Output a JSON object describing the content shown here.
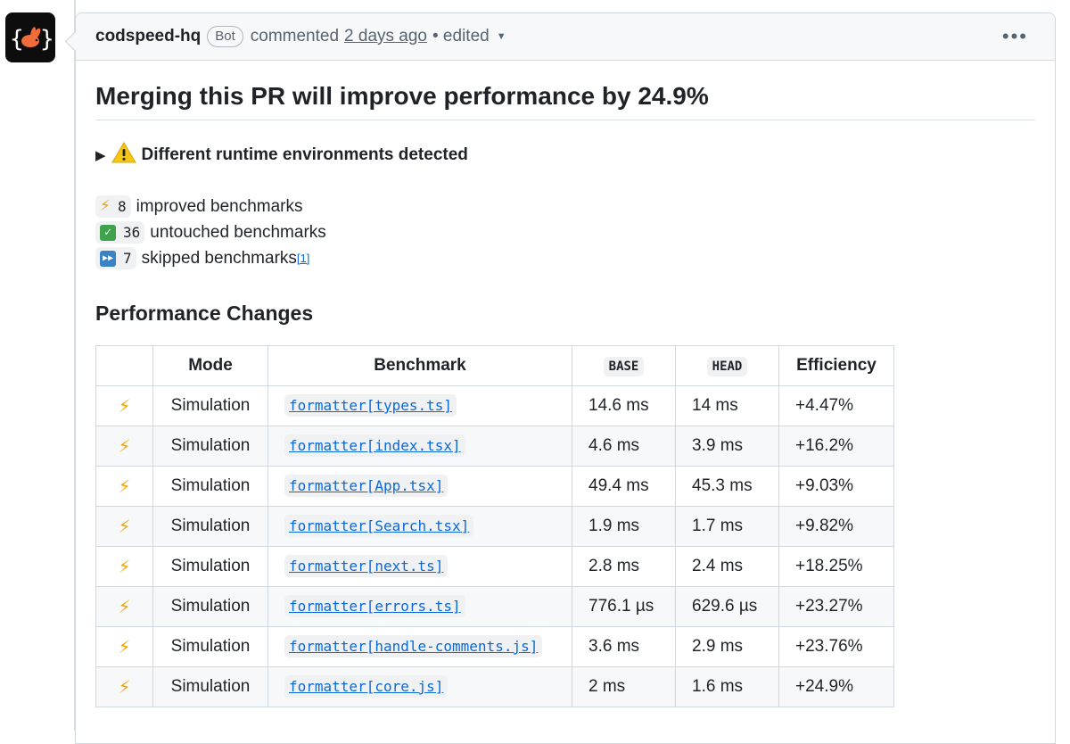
{
  "comment": {
    "author": "codspeed-hq",
    "badge": "Bot",
    "action": "commented",
    "time": "2 days ago",
    "edited": "• edited",
    "more": "•••"
  },
  "body": {
    "title": "Merging this PR will improve performance by 24.9%",
    "details": "Different runtime environments detected",
    "summary": [
      {
        "icon": "lightning-icon",
        "count": "8",
        "text": "improved benchmarks"
      },
      {
        "icon": "check-icon",
        "count": "36",
        "text": "untouched benchmarks"
      },
      {
        "icon": "fast-forward-icon",
        "count": "7",
        "text": "skipped benchmarks",
        "footnote": "[1]"
      }
    ],
    "section_title": "Performance Changes"
  },
  "table": {
    "headers": {
      "mode": "Mode",
      "benchmark": "Benchmark",
      "base": "BASE",
      "head": "HEAD",
      "efficiency": "Efficiency"
    },
    "rows": [
      {
        "icon": "⚡",
        "mode": "Simulation",
        "benchmark": "formatter[types.ts]",
        "base": "14.6 ms",
        "head": "14 ms",
        "efficiency": "+4.47%"
      },
      {
        "icon": "⚡",
        "mode": "Simulation",
        "benchmark": "formatter[index.tsx]",
        "base": "4.6 ms",
        "head": "3.9 ms",
        "efficiency": "+16.2%"
      },
      {
        "icon": "⚡",
        "mode": "Simulation",
        "benchmark": "formatter[App.tsx]",
        "base": "49.4 ms",
        "head": "45.3 ms",
        "efficiency": "+9.03%"
      },
      {
        "icon": "⚡",
        "mode": "Simulation",
        "benchmark": "formatter[Search.tsx]",
        "base": "1.9 ms",
        "head": "1.7 ms",
        "efficiency": "+9.82%"
      },
      {
        "icon": "⚡",
        "mode": "Simulation",
        "benchmark": "formatter[next.ts]",
        "base": "2.8 ms",
        "head": "2.4 ms",
        "efficiency": "+18.25%"
      },
      {
        "icon": "⚡",
        "mode": "Simulation",
        "benchmark": "formatter[errors.ts]",
        "base": "776.1 µs",
        "head": "629.6 µs",
        "efficiency": "+23.27%"
      },
      {
        "icon": "⚡",
        "mode": "Simulation",
        "benchmark": "formatter[handle-comments.js]",
        "base": "3.6 ms",
        "head": "2.9 ms",
        "efficiency": "+23.76%"
      },
      {
        "icon": "⚡",
        "mode": "Simulation",
        "benchmark": "formatter[core.js]",
        "base": "2 ms",
        "head": "1.6 ms",
        "efficiency": "+24.9%"
      }
    ]
  },
  "colors": {
    "link": "#0969da",
    "bolt": "#f1a60e",
    "border": "#d0d7de"
  }
}
